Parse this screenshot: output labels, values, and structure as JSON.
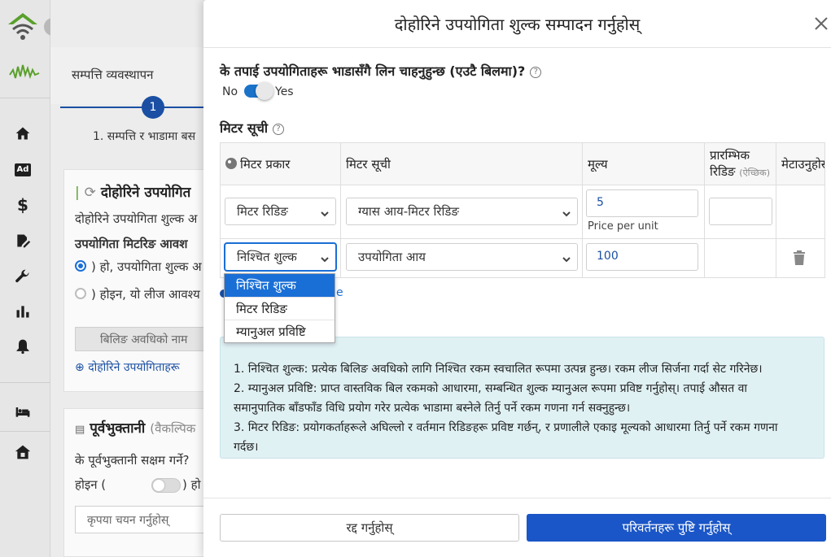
{
  "sidebar": {
    "items": [
      {
        "icon": "home-icon"
      },
      {
        "icon": "ad-icon",
        "label": "Ad"
      },
      {
        "icon": "dollar-icon",
        "label": "$"
      },
      {
        "icon": "edit-document-icon"
      },
      {
        "icon": "wrench-icon"
      },
      {
        "icon": "bar-chart-icon"
      },
      {
        "icon": "bell-icon"
      },
      {
        "icon": "bed-icon"
      },
      {
        "icon": "house-icon"
      }
    ]
  },
  "background": {
    "tab_title": "सम्पत्ति व्यवस्थापन",
    "step_number": "1",
    "step_label": "1. सम्पत्ति र भाडामा बस",
    "card1": {
      "title": "दोहोरिने उपयोगित",
      "desc": "दोहोरिने उपयोगिता शुल्क अ",
      "subheading": "उपयोगिता मिटरिङ आवश",
      "option_yes": ") हो, उपयोगिता शुल्क अ",
      "option_no": ") होइन, यो लीज आवश्य",
      "billing_button": "बिलिङ अवधिको नाम",
      "add_link": "दोहोरिने उपयोगिताहरू"
    },
    "card2": {
      "title": "पूर्वभुक्तानी",
      "title_suffix": "(वैकल्पिक",
      "question": "के पूर्वभुक्तानी सक्षम गर्ने?",
      "toggle_no": "होइन (",
      "toggle_yes": ") हो",
      "select_placeholder": "कृपया चयन गर्नुहोस्"
    }
  },
  "modal": {
    "title": "दोहोरिने उपयोगिता शुल्क सम्पादन गर्नुहोस्",
    "question": "के तपाई उपयोगिताहरू भाडासँगै लिन चाहनुहुन्छ (एउटै बिलमा)?",
    "help": "?",
    "toggle": {
      "no_label": "No",
      "yes_label": "Yes",
      "value": "Yes"
    },
    "meter_list_heading": "मिटर सूची",
    "table": {
      "headers": {
        "meter_type": "मिटर प्रकार",
        "meter_list": "मिटर सूची",
        "price": "मूल्य",
        "initial_reading": "प्रारम्भिक",
        "initial_reading_line2": "रिडिङ",
        "initial_reading_optional": "(ऐच्छिक)",
        "delete": "मेटाउनुहोस्"
      },
      "rows": [
        {
          "meter_type": "मिटर रिडिङ",
          "meter_list": "ग्यास आय-मिटर रिडिङ",
          "price": "5",
          "price_hint": "Price per unit",
          "initial_reading": ""
        },
        {
          "meter_type": "निश्चित शुल्क",
          "meter_list": "उपयोगिता आय",
          "price": "100"
        }
      ]
    },
    "dropdown_options": [
      "निश्चित शुल्क",
      "मिटर रिडिङ",
      "म्यानुअल प्रविष्टि"
    ],
    "dropdown_selected": "निश्चित शुल्क",
    "peek_letter": "e",
    "info_lines": [
      "1. निश्चित शुल्क: प्रत्येक बिलिङ अवधिको लागि निश्चित रकम स्वचालित रूपमा उत्पन्न हुन्छ। रकम लीज सिर्जना गर्दा सेट गरिनेछ।",
      "2. म्यानुअल प्रविष्टि: प्राप्त वास्तविक बिल रकमको आधारमा, सम्बन्धित शुल्क म्यानुअल रूपमा प्रविष्ट गर्नुहोस्। तपाई औसत वा",
      "समानुपातिक बाँडफाँड विधि प्रयोग गरेर प्रत्येक भाडामा बस्नेले तिर्नु पर्ने रकम गणना गर्न सक्नुहुन्छ।",
      "3. मिटर रिडिङ: प्रयोगकर्ताहरूले अघिल्लो र वर्तमान रिडिङहरू प्रविष्ट गर्छन्, र प्रणालीले एकाइ मूल्यको आधारमा तिर्नु पर्ने रकम गणना",
      "गर्दछ।"
    ],
    "cancel_label": "रद्द गर्नुहोस्",
    "confirm_label": "परिवर्तनहरू पुष्टि गर्नुहोस्"
  },
  "colors": {
    "primary": "#1a56c7",
    "toggle_on": "#1a73c9",
    "info_bg": "#e0f1f4",
    "logo_green": "#5aa02c"
  }
}
